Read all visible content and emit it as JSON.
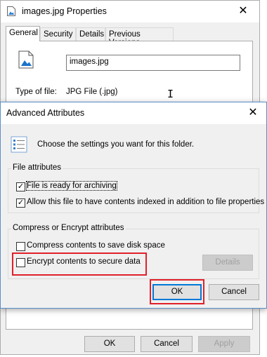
{
  "properties": {
    "title": "images.jpg Properties",
    "tabs": [
      {
        "label": "General"
      },
      {
        "label": "Security"
      },
      {
        "label": "Details"
      },
      {
        "label": "Previous Versions"
      }
    ],
    "file_name_value": "images.jpg",
    "type_label": "Type of file:",
    "type_value": "JPG File (.jpg)",
    "buttons": {
      "ok": "OK",
      "cancel": "Cancel",
      "apply": "Apply"
    }
  },
  "advanced": {
    "title": "Advanced Attributes",
    "intro": "Choose the settings you want for this folder.",
    "file_attributes": {
      "label": "File attributes",
      "archive": {
        "label": "File is ready for archiving",
        "checked": true
      },
      "index": {
        "label": "Allow this file to have contents indexed in addition to file properties",
        "checked": true
      }
    },
    "compress_encrypt": {
      "label": "Compress or Encrypt attributes",
      "compress": {
        "label": "Compress contents to save disk space",
        "checked": false
      },
      "encrypt": {
        "label": "Encrypt contents to secure data",
        "checked": false
      },
      "details_button": "Details"
    },
    "buttons": {
      "ok": "OK",
      "cancel": "Cancel"
    }
  },
  "colors": {
    "highlight": "#e0202a",
    "accent": "#0078d7"
  }
}
